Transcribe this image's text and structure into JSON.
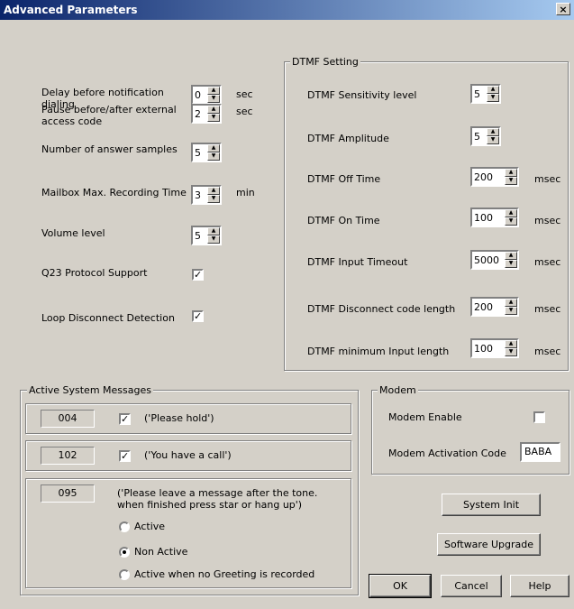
{
  "window": {
    "title": "Advanced Parameters",
    "close_label": "×"
  },
  "left_params": {
    "delay": {
      "label": "Delay before notification dialing",
      "value": "0",
      "unit": "sec"
    },
    "pause": {
      "label": "Pause before/after external access code",
      "value": "2",
      "unit": "sec"
    },
    "answer_samples": {
      "label": "Number of answer samples",
      "value": "5"
    },
    "mailbox_max": {
      "label": "Mailbox Max. Recording Time",
      "value": "3",
      "unit": "min"
    },
    "volume": {
      "label": "Volume level",
      "value": "5"
    },
    "q23": {
      "label": "Q23 Protocol Support",
      "checked": true
    },
    "loop": {
      "label": "Loop Disconnect Detection",
      "checked": true
    }
  },
  "dtmf": {
    "legend": "DTMF Setting",
    "sensitivity": {
      "label": "DTMF Sensitivity level",
      "value": "5"
    },
    "amplitude": {
      "label": "DTMF Amplitude",
      "value": "5"
    },
    "off_time": {
      "label": "DTMF Off Time",
      "value": "200",
      "unit": "msec"
    },
    "on_time": {
      "label": "DTMF On Time",
      "value": "100",
      "unit": "msec"
    },
    "input_timeout": {
      "label": "DTMF Input Timeout",
      "value": "5000",
      "unit": "msec"
    },
    "disconnect_len": {
      "label": "DTMF Disconnect code length",
      "value": "200",
      "unit": "msec"
    },
    "min_input_len": {
      "label": "DTMF minimum Input length",
      "value": "100",
      "unit": "msec"
    }
  },
  "messages": {
    "legend": "Active System Messages",
    "m1": {
      "code": "004",
      "text": "('Please hold')",
      "checked": true
    },
    "m2": {
      "code": "102",
      "text": "('You have a call')",
      "checked": true
    },
    "m3": {
      "code": "095",
      "text": "('Please leave a message after the tone. when finished press star or hang up')",
      "options": [
        "Active",
        "Non Active",
        "Active when no Greeting is recorded"
      ],
      "selected": "Non Active"
    }
  },
  "modem": {
    "legend": "Modem",
    "enable_label": "Modem Enable",
    "enable_checked": false,
    "code_label": "Modem Activation Code",
    "code_value": "BABA"
  },
  "buttons": {
    "system_init": "System Init",
    "software_upgrade": "Software Upgrade",
    "ok": "OK",
    "cancel": "Cancel",
    "help": "Help"
  },
  "icons": {
    "spin_up": "▲",
    "spin_down": "▼",
    "check": "✓"
  }
}
